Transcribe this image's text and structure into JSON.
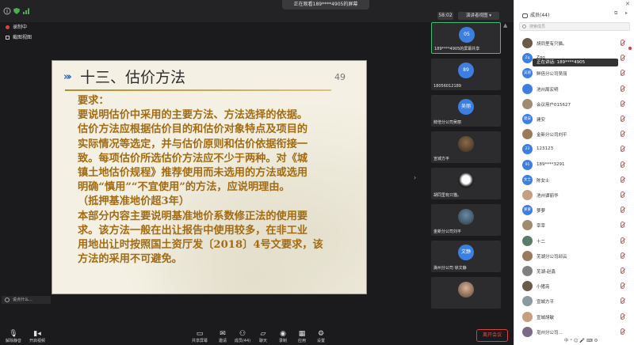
{
  "header": {
    "share_banner": "正在观看189****4905的屏幕",
    "timer": "58:02",
    "view_mode": "演讲者视图"
  },
  "recording": {
    "status": "录制中",
    "screenshot_label": "截图视图"
  },
  "slide": {
    "title": "十三、估价方法",
    "page_number": "49",
    "lines": [
      "要求：",
      "要说明估价中采用的主要方法、方法选择的依据。",
      "估价方法应根据估价目的和估价对象特点及项目的",
      "实际情况等选定，并与估价原则和估价依据衔接一",
      "致。每项估价所选估价方法应不少于两种。对《城",
      "镇土地估价规程》推荐使用而未选用的方法或选用",
      "明确“慎用”“不宜使用”的方法，应说明理由。",
      "（抵押基准地价超3年）",
      "本部分内容主要说明基准地价系数修正法的使用要",
      "求。该方法一般在出让报告中使用较多，在非工业",
      "用地出让时按照国土资厅发〔2018〕4号文要求，该",
      "方法的采用不可避免。"
    ]
  },
  "chat": {
    "placeholder": "说点什么..."
  },
  "toolbar": {
    "buttons": [
      {
        "label": "解除静音",
        "icon": "mic-off-icon"
      },
      {
        "label": "开启视频",
        "icon": "camera-off-icon"
      },
      {
        "label": "共享屏幕",
        "icon": "share-screen-icon"
      },
      {
        "label": "邀请",
        "icon": "invite-icon"
      },
      {
        "label": "成员(44)",
        "icon": "members-icon"
      },
      {
        "label": "聊天",
        "icon": "chat-icon"
      },
      {
        "label": "录制",
        "icon": "record-icon"
      },
      {
        "label": "应用",
        "icon": "apps-icon"
      },
      {
        "label": "设置",
        "icon": "settings-icon"
      }
    ],
    "end_label": "离开会议"
  },
  "videos": [
    {
      "name": "189****4905的屏幕共享",
      "avatar": "05",
      "kind": "avatar",
      "active": true
    },
    {
      "name": "18056012189",
      "avatar": "89",
      "kind": "avatar"
    },
    {
      "name": "鲜倍分公司吴丽",
      "avatar": "吴丽",
      "kind": "avatar"
    },
    {
      "name": "宣城方平",
      "avatar": "",
      "kind": "photo"
    },
    {
      "name": "胡同里有只猫。",
      "avatar": "",
      "kind": "photo"
    },
    {
      "name": "金新分公司刘平",
      "avatar": "",
      "kind": "photo"
    },
    {
      "name": "滁州分公司 徐文静",
      "avatar": "文静",
      "kind": "avatar"
    },
    {
      "name": "",
      "avatar": "",
      "kind": "photo"
    }
  ],
  "panel": {
    "title": "成员(44)",
    "search_placeholder": "搜索成员",
    "speaking_tip": "正在讲话: 189****4905",
    "members": [
      {
        "name": "胡同里有只猫。",
        "av": "",
        "photo": true
      },
      {
        "name": "Zqq",
        "av": "Zq"
      },
      {
        "name": "鲜倍分公司吴丽",
        "av": "吴丽"
      },
      {
        "name": "池州周宏明",
        "av": ""
      },
      {
        "name": "会议用户015627",
        "av": "",
        "photo": true
      },
      {
        "name": "建安",
        "av": "建安"
      },
      {
        "name": "金新分公司刘平",
        "av": "",
        "photo": true
      },
      {
        "name": "123123",
        "av": "23"
      },
      {
        "name": "189****3291",
        "av": "91"
      },
      {
        "name": "陈女士",
        "av": "女士"
      },
      {
        "name": "池州谭丽华",
        "av": "",
        "photo": true
      },
      {
        "name": "萝萝",
        "av": "萝萝"
      },
      {
        "name": "宰宰",
        "av": "",
        "photo": true
      },
      {
        "name": "十二",
        "av": "",
        "photo": true
      },
      {
        "name": "芜湖分公司邱云",
        "av": "",
        "photo": true
      },
      {
        "name": "芜湖-赵鑫",
        "av": "",
        "photo": true
      },
      {
        "name": "小猪亮",
        "av": "",
        "photo": true
      },
      {
        "name": "宣城方平",
        "av": "",
        "photo": true
      },
      {
        "name": "宣城胡敏",
        "av": "",
        "photo": true
      },
      {
        "name": "亳州分公司...",
        "av": "",
        "photo": true
      }
    ]
  },
  "tray": {
    "text": "中 ° ☺ 🎤 ⌨ ⚙"
  },
  "colors": {
    "accent_blue": "#3d7fe0",
    "slide_text": "#a36b12",
    "end_red": "#e35050"
  }
}
